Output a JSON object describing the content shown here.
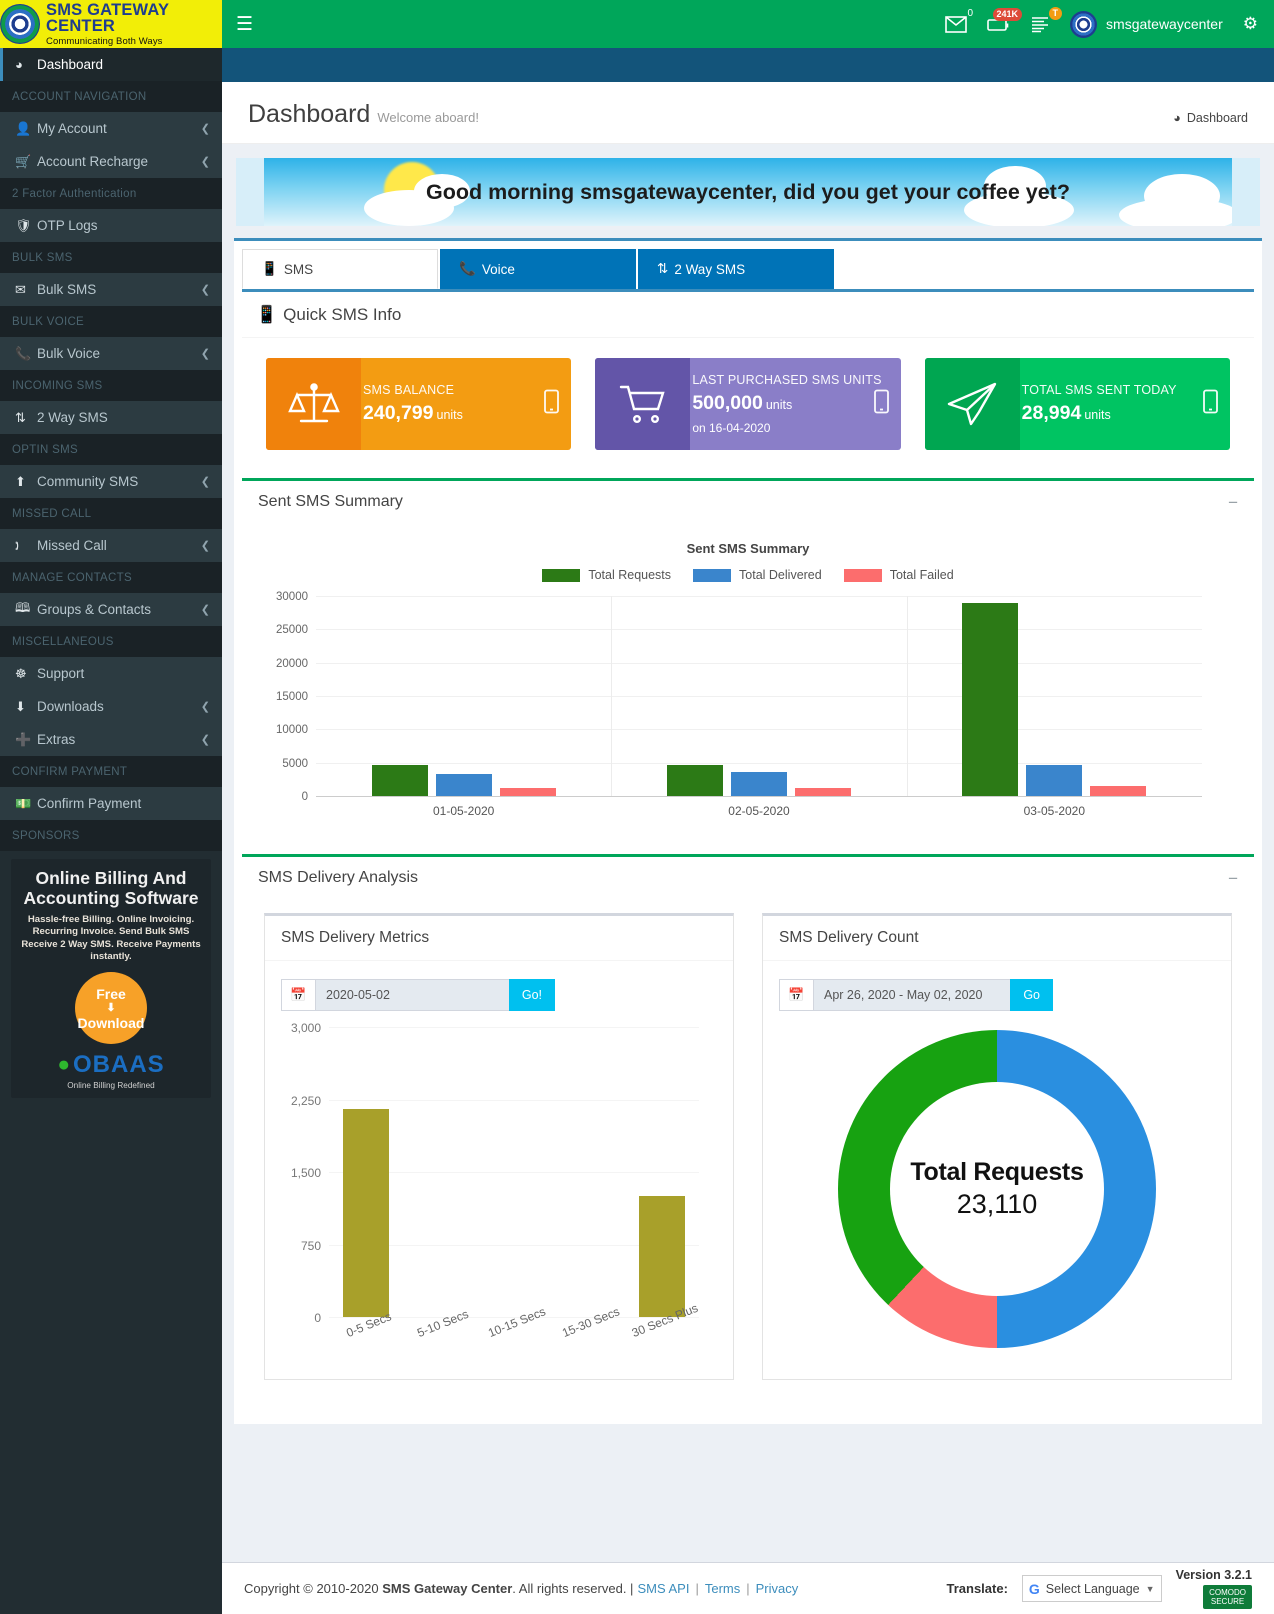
{
  "brand": {
    "title": "SMS GATEWAY CENTER",
    "tagline": "Communicating Both Ways",
    "logo_icon": "sms-gateway-logo-icon"
  },
  "topbar": {
    "menu_toggle_icon": "hamburger-menu-icon",
    "mail_icon": "envelope-icon",
    "mail_count": "0",
    "battery_icon": "battery-icon",
    "battery_badge": "241K",
    "server_icon": "server-list-icon",
    "server_badge": "T",
    "avatar_icon": "user-avatar-icon",
    "username": "smsgatewaycenter",
    "settings_icon": "gears-settings-icon"
  },
  "sidebar": {
    "items": [
      {
        "type": "item",
        "label": "Dashboard",
        "icon": "dashboard-icon",
        "active": true,
        "arrow": false
      },
      {
        "type": "header",
        "label": "ACCOUNT NAVIGATION"
      },
      {
        "type": "item",
        "label": "My Account",
        "icon": "user-icon",
        "arrow": true
      },
      {
        "type": "item",
        "label": "Account Recharge",
        "icon": "cart-icon",
        "arrow": true
      },
      {
        "type": "header",
        "label": "2 Factor Authentication"
      },
      {
        "type": "item",
        "label": "OTP Logs",
        "icon": "shield-icon",
        "arrow": false
      },
      {
        "type": "header",
        "label": "BULK SMS"
      },
      {
        "type": "item",
        "label": "Bulk SMS",
        "icon": "envelope-icon",
        "arrow": true
      },
      {
        "type": "header",
        "label": "BULK VOICE"
      },
      {
        "type": "item",
        "label": "Bulk Voice",
        "icon": "phone-icon",
        "arrow": true
      },
      {
        "type": "header",
        "label": "INCOMING SMS"
      },
      {
        "type": "item",
        "label": "2 Way SMS",
        "icon": "retweet-icon",
        "arrow": false
      },
      {
        "type": "header",
        "label": "OPTIN SMS"
      },
      {
        "type": "item",
        "label": "Community SMS",
        "icon": "upload-icon",
        "arrow": true
      },
      {
        "type": "header",
        "label": "MISSED CALL"
      },
      {
        "type": "item",
        "label": "Missed Call",
        "icon": "missed-call-icon",
        "arrow": true
      },
      {
        "type": "header",
        "label": "MANAGE CONTACTS"
      },
      {
        "type": "item",
        "label": "Groups & Contacts",
        "icon": "address-book-icon",
        "arrow": true
      },
      {
        "type": "header",
        "label": "MISCELLANEOUS"
      },
      {
        "type": "item",
        "label": "Support",
        "icon": "lifebuoy-icon",
        "arrow": false
      },
      {
        "type": "item",
        "label": "Downloads",
        "icon": "download-icon",
        "arrow": true
      },
      {
        "type": "item",
        "label": "Extras",
        "icon": "plus-icon",
        "arrow": true
      },
      {
        "type": "header",
        "label": "CONFIRM PAYMENT"
      },
      {
        "type": "item",
        "label": "Confirm Payment",
        "icon": "money-icon",
        "arrow": false
      },
      {
        "type": "header",
        "label": "SPONSORS"
      }
    ],
    "sponsor": {
      "line1": "Online Billing And Accounting Software",
      "line2": "Hassle-free Billing. Online Invoicing. Recurring Invoice. Send Bulk SMS  Receive 2 Way SMS. Receive Payments instantly.",
      "cta_top": "Free",
      "cta_bottom": "Download",
      "brand": "OBAAS",
      "brand_sub": "Online Billing Redefined"
    }
  },
  "page": {
    "title": "Dashboard",
    "subtitle": "Welcome aboard!",
    "breadcrumb": "Dashboard",
    "breadcrumb_icon": "dashboard-icon",
    "greeting": "Good morning smsgatewaycenter, did you get your coffee yet?"
  },
  "tabs": [
    {
      "label": "SMS",
      "icon": "mobile-icon",
      "active": true
    },
    {
      "label": "Voice",
      "icon": "phone-icon",
      "active": false
    },
    {
      "label": "2 Way SMS",
      "icon": "retweet-icon",
      "active": false
    }
  ],
  "quick_sms": {
    "title": "Quick SMS Info",
    "title_icon": "mobile-icon",
    "boxes": [
      {
        "label": "SMS BALANCE",
        "value": "240,799",
        "unit": "units",
        "sub": "",
        "icon": "balance-scale-icon",
        "color": "#f39c12"
      },
      {
        "label": "LAST PURCHASED SMS UNITS",
        "value": "500,000",
        "unit": "units",
        "sub": "on 16-04-2020",
        "icon": "shopping-cart-icon",
        "color": "#8a7ec8"
      },
      {
        "label": "TOTAL SMS SENT TODAY",
        "value": "28,994",
        "unit": "units",
        "sub": "",
        "icon": "paper-plane-icon",
        "color": "#00c462"
      }
    ]
  },
  "sent_summary": {
    "card_title": "Sent SMS Summary",
    "collapse_icon": "minus-icon"
  },
  "delivery_analysis": {
    "card_title": "SMS Delivery Analysis",
    "collapse_icon": "minus-icon",
    "metrics": {
      "title": "SMS Delivery Metrics",
      "date_value": "2020-05-02",
      "date_icon": "calendar-icon",
      "go_label": "Go!"
    },
    "count": {
      "title": "SMS Delivery Count",
      "date_value": "Apr 26, 2020 - May 02, 2020",
      "date_icon": "calendar-icon",
      "go_label": "Go"
    }
  },
  "footer": {
    "copyright_prefix": "Copyright © 2010-2020",
    "company": "SMS Gateway Center",
    "rights": ". All rights reserved. |",
    "links": [
      "SMS API",
      "Terms",
      "Privacy"
    ],
    "translate_label": "Translate:",
    "select_language": "Select Language",
    "google_icon": "google-g-icon",
    "version": "Version 3.2.1",
    "version_label": "Version",
    "version_number": "3.2.1",
    "seal_top": "COMODO",
    "seal_bottom": "SECURE"
  },
  "chart_data": [
    {
      "type": "bar",
      "id": "sent-sms-summary",
      "title": "Sent SMS Summary",
      "categories": [
        "01-05-2020",
        "02-05-2020",
        "03-05-2020"
      ],
      "series": [
        {
          "name": "Total Requests",
          "color": "#2c7a16",
          "values": [
            4700,
            4700,
            29000
          ]
        },
        {
          "name": "Total Delivered",
          "color": "#3a85cc",
          "values": [
            3350,
            3550,
            4700
          ]
        },
        {
          "name": "Total Failed",
          "color": "#fc6d6d",
          "values": [
            1150,
            1150,
            1500
          ]
        }
      ],
      "xlabel": "",
      "ylabel": "",
      "ylim": [
        0,
        30000
      ],
      "yticks": [
        0,
        5000,
        10000,
        15000,
        20000,
        25000,
        30000
      ],
      "grid": true,
      "legend_position": "top"
    },
    {
      "type": "bar",
      "id": "sms-delivery-metrics",
      "title": "SMS Delivery Metrics",
      "categories": [
        "0-5 Secs",
        "5-10 Secs",
        "10-15 Secs",
        "15-30 Secs",
        "30 Secs Plus"
      ],
      "values": [
        2150,
        0,
        0,
        0,
        1250
      ],
      "color": "#a8a02a",
      "xlabel": "",
      "ylabel": "",
      "ylim": [
        0,
        3000
      ],
      "yticks": [
        "0",
        "750",
        "1,500",
        "2,250",
        "3,000"
      ],
      "ytick_values": [
        0,
        750,
        1500,
        2250,
        3000
      ],
      "grid": true,
      "legend_position": "none"
    },
    {
      "type": "pie",
      "id": "sms-delivery-count",
      "title": "SMS Delivery Count",
      "center_label": "Total Requests",
      "center_value": "23,110",
      "total": 23110,
      "slices": [
        {
          "name": "Total Delivered",
          "color": "#2a8fe0",
          "percent": 50
        },
        {
          "name": "Total Failed",
          "color": "#fc6d6d",
          "percent": 12
        },
        {
          "name": "Total Requests",
          "color": "#17a211",
          "percent": 38
        }
      ],
      "legend_position": "none"
    }
  ]
}
